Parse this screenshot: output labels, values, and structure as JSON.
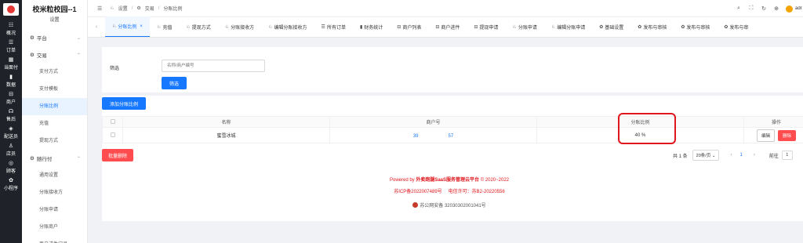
{
  "rail": {
    "items": [
      {
        "icon": "☷",
        "label": "概况"
      },
      {
        "icon": "☰",
        "label": "订单"
      },
      {
        "icon": "▦",
        "label": "当面付"
      },
      {
        "icon": "▮",
        "label": "数据"
      },
      {
        "icon": "⊟",
        "label": "商户"
      },
      {
        "icon": "☊",
        "label": "售后"
      },
      {
        "icon": "◈",
        "label": "配送员"
      },
      {
        "icon": "♙",
        "label": "店员"
      },
      {
        "icon": "◎",
        "label": "顾客"
      },
      {
        "icon": "✿",
        "label": "小程序"
      }
    ]
  },
  "sidebar": {
    "school": "校米粒校园--1",
    "subtitle": "设置",
    "group_platform": "平台",
    "group_trade": "交易",
    "trade_items": [
      "支付方式",
      "支付模板",
      "分账比例",
      "充值",
      "提现方式"
    ],
    "group_pay": "随行付",
    "pay_items": [
      "通用设置",
      "分账接收方",
      "分账申请",
      "分账商户",
      "商户进件记录"
    ]
  },
  "topbar": {
    "toggle": "☰",
    "crumb_settings": "设置",
    "crumb_trade": "交易",
    "crumb_current": "分账比例",
    "user": "adr"
  },
  "tabs": [
    {
      "icon": "♘",
      "label": "分账比例",
      "active": true
    },
    {
      "icon": "♘",
      "label": "充值"
    },
    {
      "icon": "♘",
      "label": "提现方式"
    },
    {
      "icon": "♘",
      "label": "分账接收方"
    },
    {
      "icon": "♘",
      "label": "编辑分账接收方"
    },
    {
      "icon": "☰",
      "label": "所有订单"
    },
    {
      "icon": "▮",
      "label": "财务统计"
    },
    {
      "icon": "⊟",
      "label": "商户列表"
    },
    {
      "icon": "⊟",
      "label": "商户进件"
    },
    {
      "icon": "⊟",
      "label": "提现申请"
    },
    {
      "icon": "♘",
      "label": "分账申请"
    },
    {
      "icon": "♘",
      "label": "编辑分账申请"
    },
    {
      "icon": "✿",
      "label": "基础设置"
    },
    {
      "icon": "✿",
      "label": "发布与审核"
    },
    {
      "icon": "✿",
      "label": "发布与审核"
    },
    {
      "icon": "✿",
      "label": "发布与审"
    }
  ],
  "filter": {
    "label": "筛选",
    "placeholder": "名称/商户编号",
    "button": "筛选"
  },
  "table": {
    "add_button": "添加分账比例",
    "headers": {
      "name": "名称",
      "merchant": "商户号",
      "ratio": "分账比例",
      "ops": "操作"
    },
    "rows": [
      {
        "name": "蜜雪冰城",
        "merchant_prefix": "39",
        "merchant_suffix": "57",
        "ratio": "40 %",
        "edit": "编辑",
        "delete": "删除"
      }
    ],
    "batch_delete": "批量删除"
  },
  "pager": {
    "total": "共 1 条",
    "per_page": "20条/页",
    "page": "1",
    "goto_label": "前往",
    "goto_value": "1"
  },
  "footer": {
    "powered_prefix": "Powered by ",
    "powered_brand": "外卖跑腿SaaS服务管理云平台",
    "powered_years": "© 2020~2022",
    "icp": "苏ICP备2022007489号",
    "telecom": "电信许可：苏B2-20220556",
    "police": "苏公网安备 32030302001041号"
  },
  "colors": {
    "accent": "#1677ff",
    "danger": "#ff4d4f",
    "highlight": "#e0161b"
  }
}
